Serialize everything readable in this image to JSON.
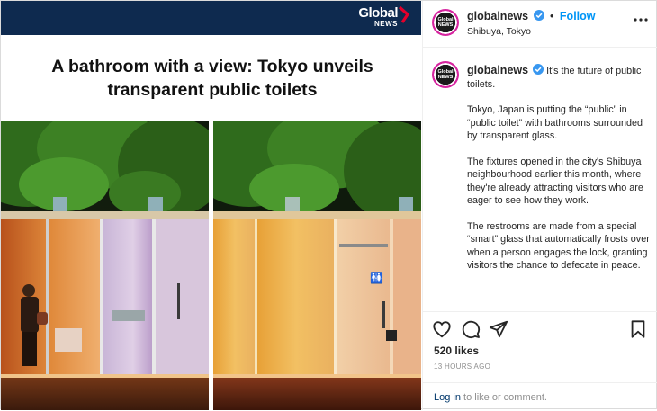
{
  "media": {
    "logo_word": "Global",
    "logo_sub": "NEWS",
    "headline_line1": "A bathroom with a view: Tokyo unveils",
    "headline_line2": "transparent public toilets"
  },
  "post_header": {
    "username": "globalnews",
    "separator": "•",
    "follow_label": "Follow",
    "location": "Shibuya, Tokyo",
    "avatar_text_1": "Global",
    "avatar_text_2": "NEWS"
  },
  "caption": {
    "username": "globalnews",
    "lead": "It's the future of public toilets.",
    "paragraphs": [
      "Tokyo, Japan is putting the “public” in “public toilet” with bathrooms surrounded by transparent glass.",
      "The fixtures opened in the city's Shibuya neighbourhood earlier this month, where they're already attracting visitors who are eager to see how they work.",
      "The restrooms are made from a special “smart” glass that automatically frosts over when a person engages the lock, granting visitors the chance to defecate in peace."
    ]
  },
  "actions": {
    "like_icon": "heart-icon",
    "comment_icon": "comment-icon",
    "share_icon": "paper-plane-icon",
    "save_icon": "bookmark-icon",
    "likes_text": "520 likes",
    "timestamp": "13 HOURS AGO",
    "login_link": "Log in",
    "login_rest": " to like or comment."
  },
  "colors": {
    "brand_bar": "#0e2a4f",
    "follow_blue": "#0095f6",
    "text": "#262626",
    "muted": "#8e8e8e"
  }
}
